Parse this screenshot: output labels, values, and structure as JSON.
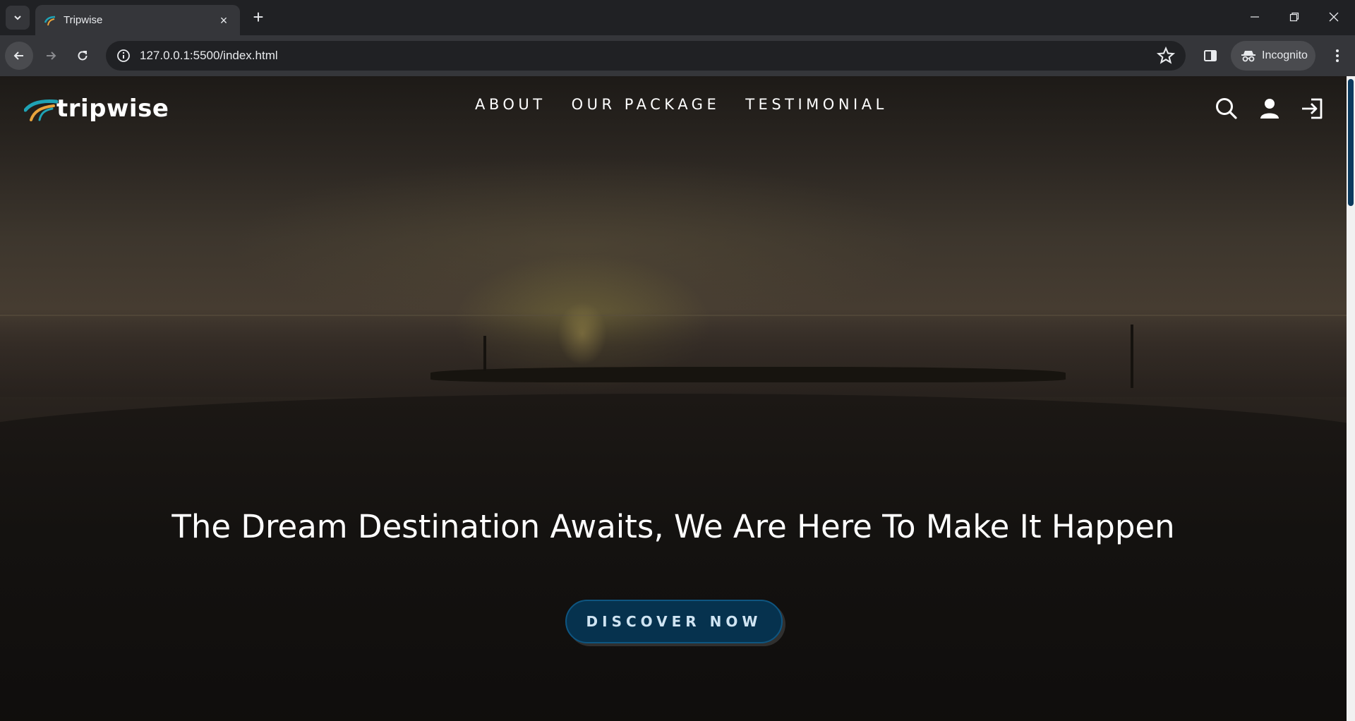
{
  "browser": {
    "tab_title": "Tripwise",
    "url": "127.0.0.1:5500/index.html",
    "incognito_label": "Incognito",
    "icons": {
      "tab_search": "chevron-down-icon",
      "tab_close": "close-icon",
      "new_tab": "plus-icon",
      "minimize": "minimize-icon",
      "restore": "restore-icon",
      "close_window": "close-icon",
      "back": "arrow-left-icon",
      "forward": "arrow-right-icon",
      "reload": "reload-icon",
      "site_info": "info-icon",
      "bookmark": "star-icon",
      "side_panel": "side-panel-icon",
      "menu": "more-vert-icon"
    },
    "tab_close_glyph": "×",
    "new_tab_glyph": "+"
  },
  "site": {
    "logo_text": "tripwise",
    "nav": [
      {
        "label": "ABOUT"
      },
      {
        "label": "OUR PACKAGE"
      },
      {
        "label": "TESTIMONIAL"
      }
    ],
    "header_icons": [
      "search-icon",
      "user-icon",
      "login-icon"
    ],
    "headline": "The Dream Destination Awaits, We Are Here To Make It Happen",
    "cta_label": "DISCOVER NOW",
    "colors": {
      "cta_background": "#06324e",
      "cta_border": "#0e5580",
      "logo_teal": "#1fa3b5",
      "logo_orange": "#e8a33c"
    }
  }
}
